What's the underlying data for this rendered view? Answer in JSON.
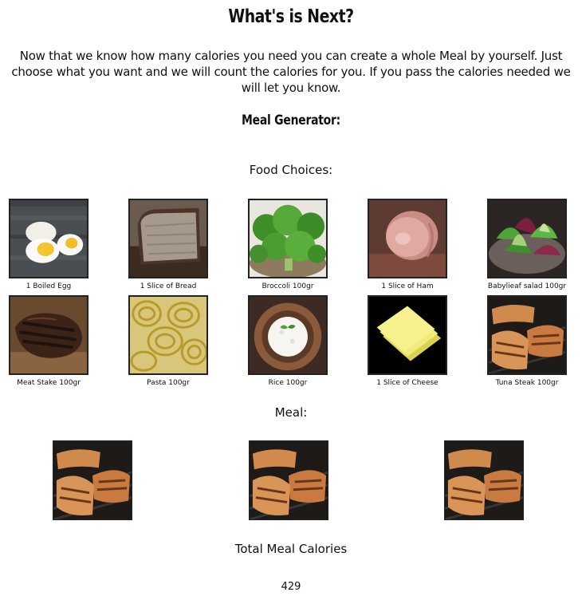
{
  "page": {
    "title": "What's is Next?",
    "intro": "Now that we know how many calories you need you can create a whole Meal by yourself. Just choose what you want and we will count the calories for you. If you pass the calories needed we will let you know.",
    "generator_heading": "Meal Generator:",
    "food_choices_heading": "Food Choices:",
    "meal_heading": "Meal:",
    "total_heading": "Total Meal Calories",
    "total_value": "429"
  },
  "foods": [
    {
      "label": "1 Boiled Egg",
      "icon": "boiled-egg-image"
    },
    {
      "label": "1 Slice of Bread",
      "icon": "bread-image"
    },
    {
      "label": "Broccoli 100gr",
      "icon": "broccoli-image"
    },
    {
      "label": "1 Slice of Ham",
      "icon": "ham-image"
    },
    {
      "label": "Babylieaf salad 100gr",
      "icon": "salad-image"
    },
    {
      "label": "Meat Stake 100gr",
      "icon": "steak-image"
    },
    {
      "label": "Pasta 100gr",
      "icon": "pasta-image"
    },
    {
      "label": "Rice 100gr",
      "icon": "rice-image"
    },
    {
      "label": "1 Slice of Cheese",
      "icon": "cheese-image"
    },
    {
      "label": "Tuna Steak 100gr",
      "icon": "tuna-steak-image"
    }
  ],
  "meal": [
    {
      "icon": "tuna-steak-image"
    },
    {
      "icon": "tuna-steak-image"
    },
    {
      "icon": "tuna-steak-image"
    }
  ]
}
